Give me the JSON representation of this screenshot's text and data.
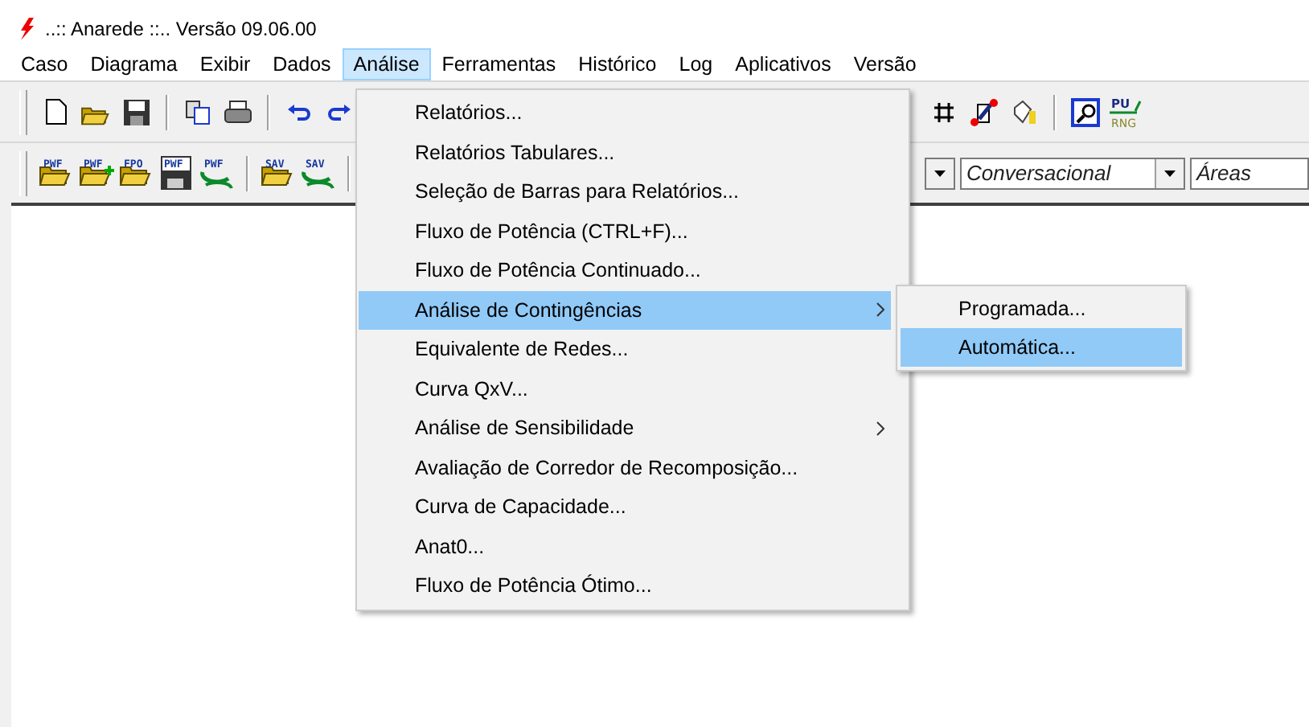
{
  "window": {
    "title": "..:: Anarede ::.. Versão 09.06.00"
  },
  "menu_bar": [
    {
      "label": "Caso",
      "selected": false
    },
    {
      "label": "Diagrama",
      "selected": false
    },
    {
      "label": "Exibir",
      "selected": false
    },
    {
      "label": "Dados",
      "selected": false
    },
    {
      "label": "Análise",
      "selected": true
    },
    {
      "label": "Ferramentas",
      "selected": false
    },
    {
      "label": "Histórico",
      "selected": false
    },
    {
      "label": "Log",
      "selected": false
    },
    {
      "label": "Aplicativos",
      "selected": false
    },
    {
      "label": "Versão",
      "selected": false
    }
  ],
  "toolbar_2": {
    "file_buttons": [
      {
        "label": "PWF",
        "kind": "open"
      },
      {
        "label": "PWF",
        "kind": "add"
      },
      {
        "label": "FPO",
        "kind": "open"
      },
      {
        "label": "PWF",
        "kind": "save"
      },
      {
        "label": "PWF",
        "kind": "refresh"
      }
    ],
    "sav_buttons": [
      {
        "label": "SAV",
        "kind": "open"
      },
      {
        "label": "SAV",
        "kind": "refresh"
      }
    ],
    "combos": [
      {
        "value": "Conversacional"
      },
      {
        "value": "Áreas"
      }
    ]
  },
  "pu_rng_button": {
    "top": "PU",
    "bottom": "RNG"
  },
  "analysis_menu": [
    {
      "label": "Relatórios...",
      "selected": false,
      "has_submenu": false
    },
    {
      "label": "Relatórios Tabulares...",
      "selected": false,
      "has_submenu": false
    },
    {
      "label": "Seleção de Barras para Relatórios...",
      "selected": false,
      "has_submenu": false
    },
    {
      "label": "Fluxo de Potência (CTRL+F)...",
      "selected": false,
      "has_submenu": false
    },
    {
      "label": "Fluxo de Potência Continuado...",
      "selected": false,
      "has_submenu": false
    },
    {
      "label": "Análise de Contingências",
      "selected": true,
      "has_submenu": true
    },
    {
      "label": "Equivalente de Redes...",
      "selected": false,
      "has_submenu": false
    },
    {
      "label": "Curva QxV...",
      "selected": false,
      "has_submenu": false
    },
    {
      "label": "Análise de Sensibilidade",
      "selected": false,
      "has_submenu": true
    },
    {
      "label": "Avaliação de Corredor de Recomposição...",
      "selected": false,
      "has_submenu": false
    },
    {
      "label": "Curva de Capacidade...",
      "selected": false,
      "has_submenu": false
    },
    {
      "label": "Anat0...",
      "selected": false,
      "has_submenu": false
    },
    {
      "label": "Fluxo de Potência Ótimo...",
      "selected": false,
      "has_submenu": false
    }
  ],
  "contingency_submenu": [
    {
      "label": "Programada...",
      "selected": false
    },
    {
      "label": "Automática...",
      "selected": true
    }
  ]
}
